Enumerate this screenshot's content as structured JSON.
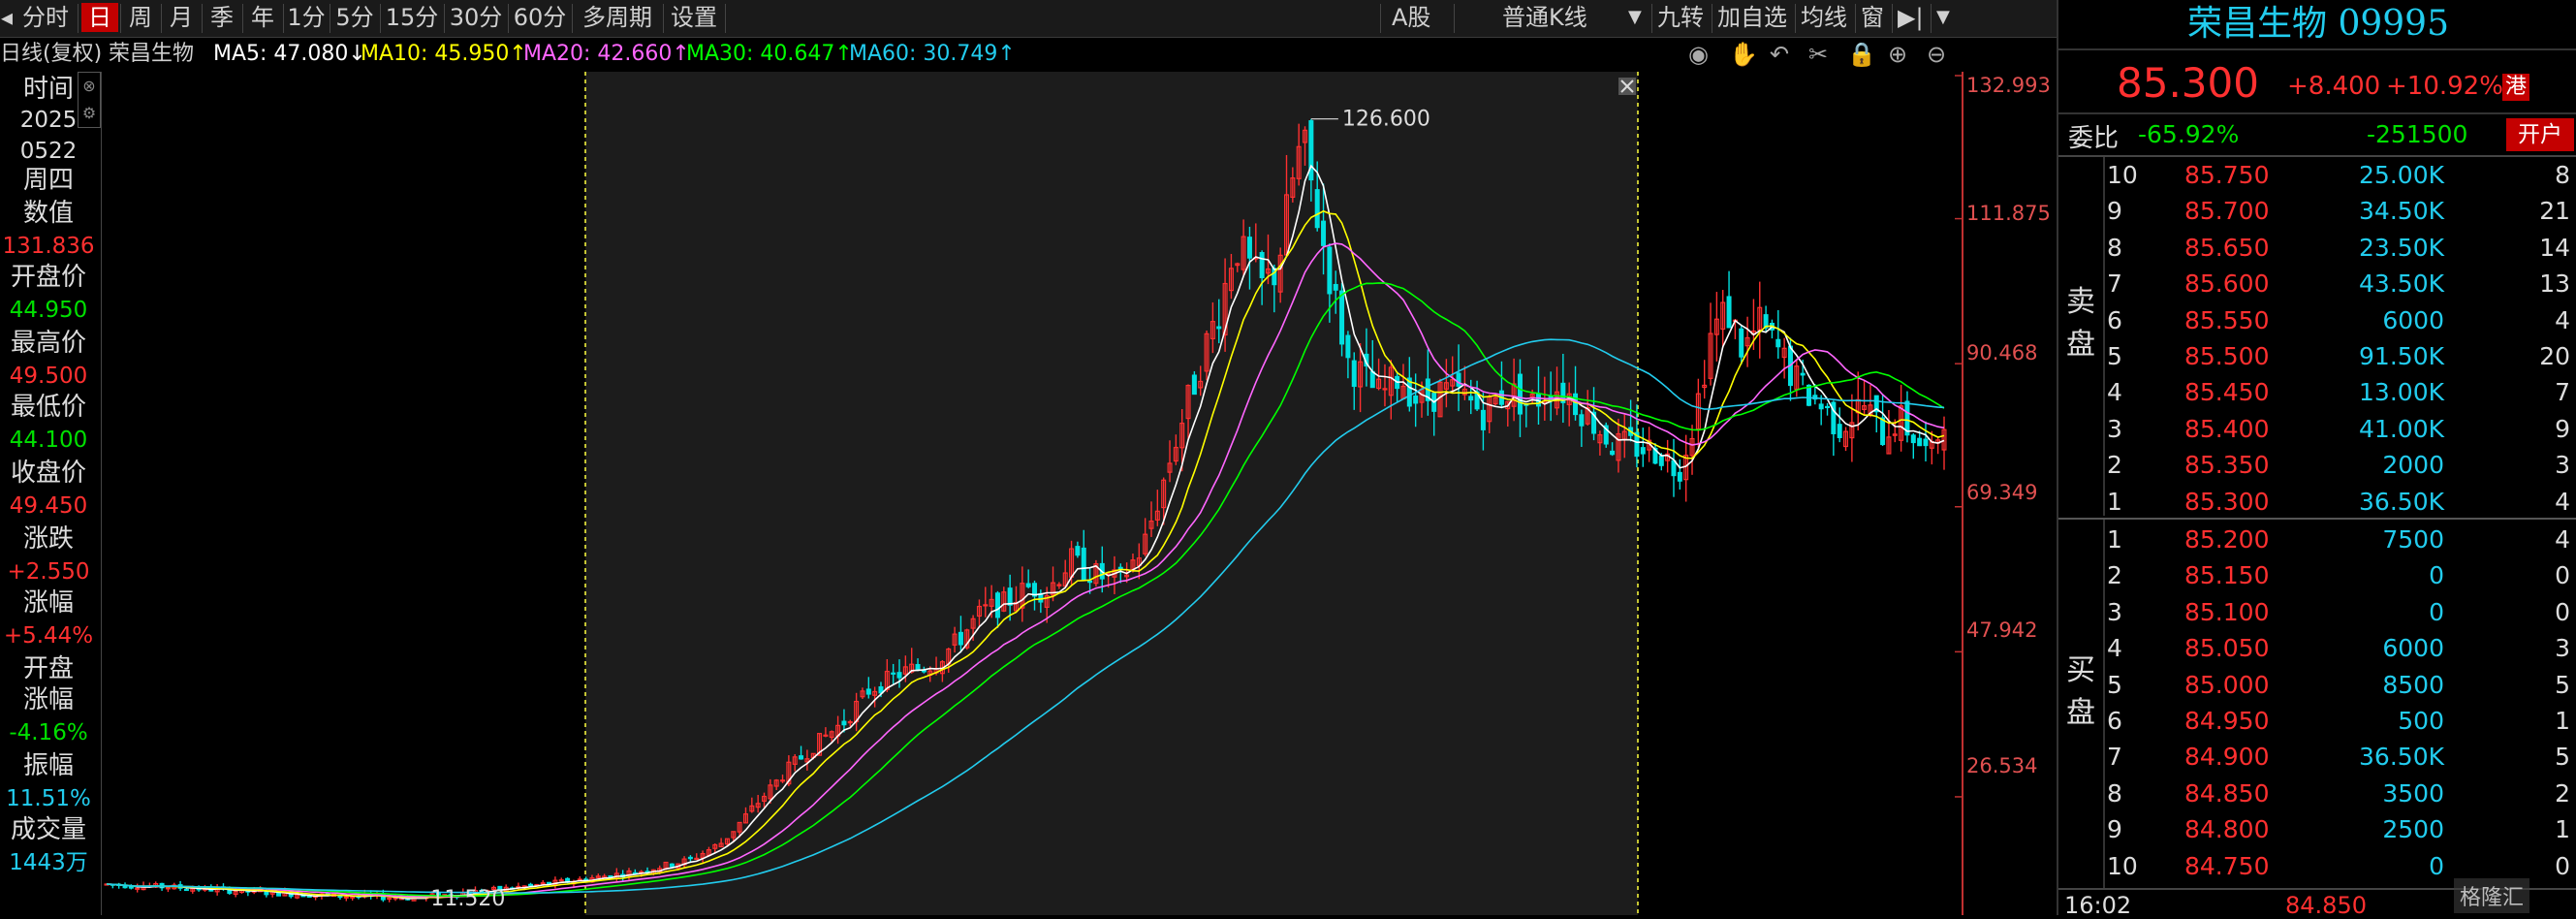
{
  "toolbar": {
    "tabs": [
      "分时",
      "日",
      "周",
      "月",
      "季",
      "年",
      "1分",
      "5分",
      "15分",
      "30分",
      "60分",
      "多周期",
      "设置"
    ],
    "active_tab": "日",
    "market": "A股",
    "chart_type": "普通K线",
    "jiuzhuan": "九转",
    "add_watch": "加自选",
    "ma_line": "均线",
    "window": "窗"
  },
  "ma_bar": {
    "mode": "日线(复权)",
    "name": "荣昌生物",
    "ma5": "MA5: 47.080↓",
    "ma10": "MA10: 45.950↑",
    "ma20": "MA20: 42.660↑",
    "ma30": "MA30: 40.647↑",
    "ma60": "MA60: 30.749↑"
  },
  "left_info": {
    "time_label": "时间",
    "year": "2025",
    "date": "0522",
    "weekday": "周四",
    "value_label": "数值",
    "value": "131.836",
    "open_label": "开盘价",
    "open": "44.950",
    "high_label": "最高价",
    "high": "49.500",
    "low_label": "最低价",
    "low": "44.100",
    "close_label": "收盘价",
    "close": "49.450",
    "change_label": "涨跌",
    "change": "+2.550",
    "pct_label": "涨幅",
    "pct": "+5.44%",
    "open_pct_label1": "开盘",
    "open_pct_label2": "涨幅",
    "open_pct": "-4.16%",
    "amp_label": "振幅",
    "amp": "11.51%",
    "vol_label": "成交量",
    "vol": "1443万"
  },
  "axis": {
    "labels": [
      "132.993",
      "111.875",
      "90.468",
      "69.349",
      "47.942",
      "26.534"
    ]
  },
  "annotations": {
    "peak": "126.600",
    "trough": "11.520"
  },
  "quote": {
    "title": "荣昌生物 09995",
    "price": "85.300",
    "change": "+8.400",
    "pct": "+10.92%",
    "hk": "港",
    "weibi_label": "委比",
    "weibi": "-65.92%",
    "weicha": "-251500",
    "open_button": "开户",
    "sell_label": [
      "卖",
      "盘"
    ],
    "buy_label": [
      "买",
      "盘"
    ],
    "asks": [
      {
        "lvl": "10",
        "price": "85.750",
        "vol": "25.00K",
        "cnt": "8"
      },
      {
        "lvl": "9",
        "price": "85.700",
        "vol": "34.50K",
        "cnt": "21"
      },
      {
        "lvl": "8",
        "price": "85.650",
        "vol": "23.50K",
        "cnt": "14"
      },
      {
        "lvl": "7",
        "price": "85.600",
        "vol": "43.50K",
        "cnt": "13"
      },
      {
        "lvl": "6",
        "price": "85.550",
        "vol": "6000",
        "cnt": "4"
      },
      {
        "lvl": "5",
        "price": "85.500",
        "vol": "91.50K",
        "cnt": "20"
      },
      {
        "lvl": "4",
        "price": "85.450",
        "vol": "13.00K",
        "cnt": "7"
      },
      {
        "lvl": "3",
        "price": "85.400",
        "vol": "41.00K",
        "cnt": "9"
      },
      {
        "lvl": "2",
        "price": "85.350",
        "vol": "2000",
        "cnt": "3"
      },
      {
        "lvl": "1",
        "price": "85.300",
        "vol": "36.50K",
        "cnt": "4"
      }
    ],
    "bids": [
      {
        "lvl": "1",
        "price": "85.200",
        "vol": "7500",
        "cnt": "4"
      },
      {
        "lvl": "2",
        "price": "85.150",
        "vol": "0",
        "cnt": "0"
      },
      {
        "lvl": "3",
        "price": "85.100",
        "vol": "0",
        "cnt": "0"
      },
      {
        "lvl": "4",
        "price": "85.050",
        "vol": "6000",
        "cnt": "3"
      },
      {
        "lvl": "5",
        "price": "85.000",
        "vol": "8500",
        "cnt": "5"
      },
      {
        "lvl": "6",
        "price": "84.950",
        "vol": "500",
        "cnt": "1"
      },
      {
        "lvl": "7",
        "price": "84.900",
        "vol": "36.50K",
        "cnt": "5"
      },
      {
        "lvl": "8",
        "price": "84.850",
        "vol": "3500",
        "cnt": "2"
      },
      {
        "lvl": "9",
        "price": "84.800",
        "vol": "2500",
        "cnt": "1"
      },
      {
        "lvl": "10",
        "price": "84.750",
        "vol": "0",
        "cnt": "0"
      }
    ],
    "last_time": "16:02",
    "last_price": "84.850",
    "watermark": "格隆汇"
  },
  "colors": {
    "up": "#ff3030",
    "down": "#00e0e0",
    "ma5": "#ffffff",
    "ma10": "#ffff00",
    "ma20": "#ff66ff",
    "ma30": "#00ff00",
    "ma60": "#22ccee",
    "range_bg": "#1c1c1c",
    "accent_red": "#c40000"
  }
}
